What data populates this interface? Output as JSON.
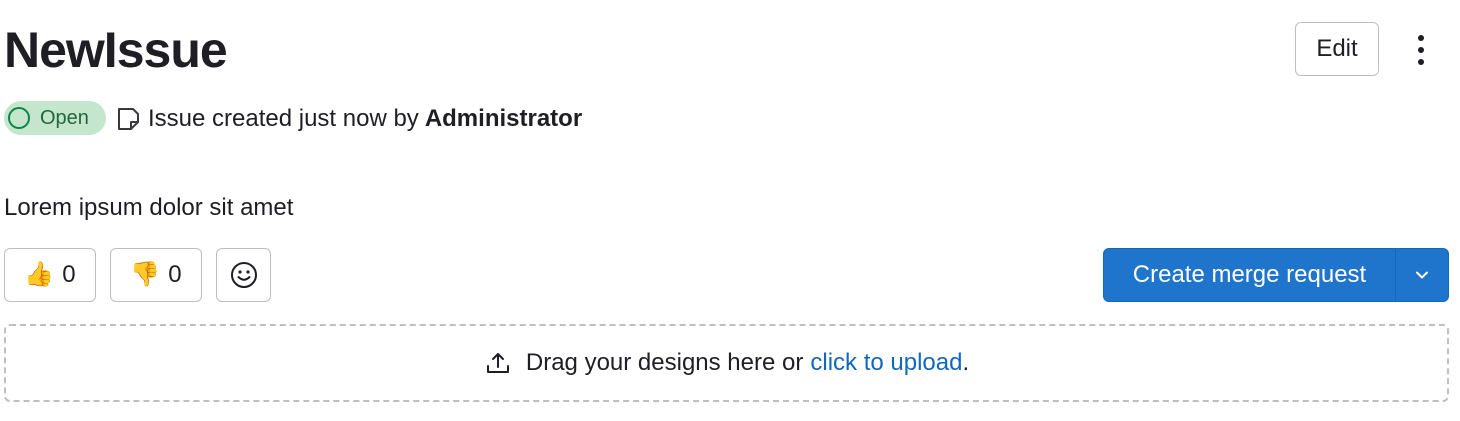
{
  "issue": {
    "title": "NewIssue",
    "status": "Open",
    "meta_text": "Issue created just now by",
    "author": "Administrator",
    "description": "Lorem ipsum dolor sit amet"
  },
  "actions": {
    "edit_label": "Edit",
    "create_mr_label": "Create merge request"
  },
  "reactions": {
    "thumbs_up": {
      "emoji": "👍",
      "count": "0"
    },
    "thumbs_down": {
      "emoji": "👎",
      "count": "0"
    }
  },
  "design_upload": {
    "text": "Drag your designs here or",
    "link_text": "click to upload",
    "suffix": "."
  },
  "colors": {
    "primary": "#1f75cb",
    "open_badge_bg": "#c3e6cd",
    "open_badge_text": "#24663b",
    "link": "#1068bf"
  }
}
